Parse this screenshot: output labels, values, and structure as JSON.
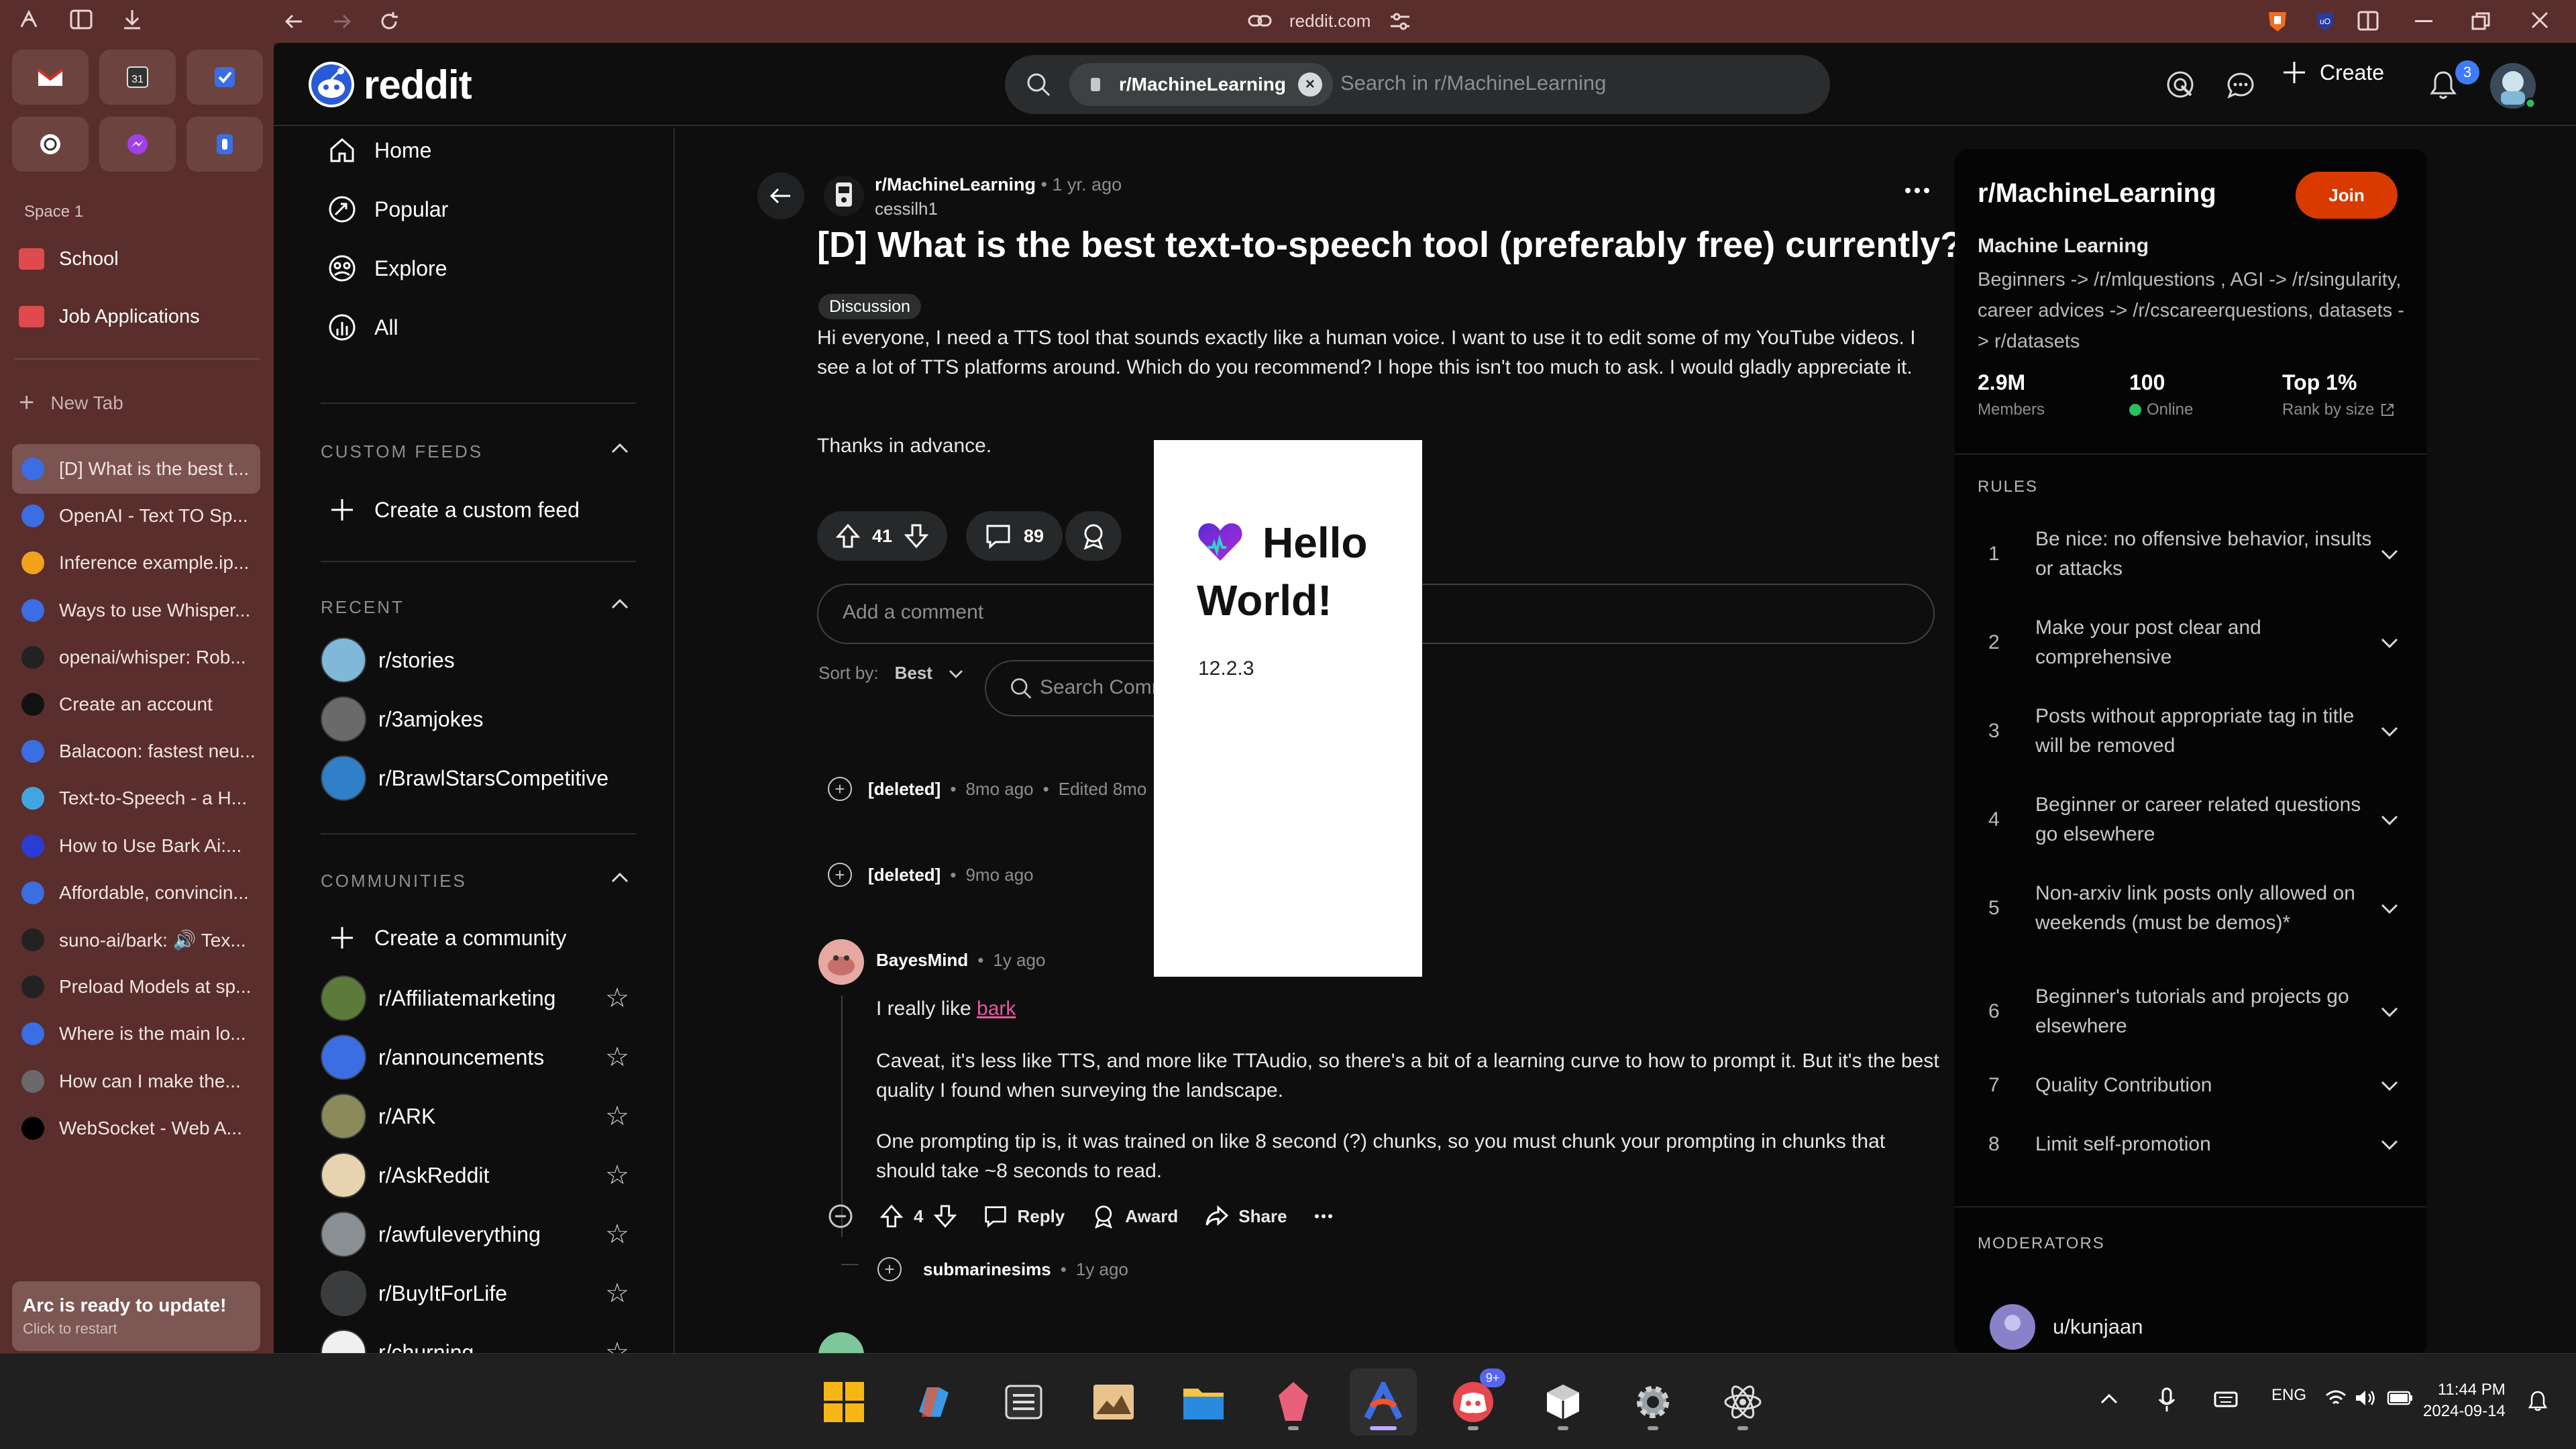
{
  "browser": {
    "url": "reddit.com",
    "space_label": "Space 1",
    "folders": [
      "School",
      "Job Applications"
    ],
    "new_tab_label": "New Tab",
    "tabs": [
      {
        "title": "[D] What is the best t...",
        "color": "#3b6de3",
        "active": true
      },
      {
        "title": "OpenAI - Text TO Sp...",
        "color": "#3b6de3"
      },
      {
        "title": "Inference example.ip...",
        "color": "#f2a21b"
      },
      {
        "title": "Ways to use Whisper...",
        "color": "#3b6de3"
      },
      {
        "title": "openai/whisper: Rob...",
        "color": "#222222"
      },
      {
        "title": "Create an account",
        "color": "#111111"
      },
      {
        "title": "Balacoon: fastest neu...",
        "color": "#3b6de3"
      },
      {
        "title": "Text-to-Speech - a H...",
        "color": "#42a5e0"
      },
      {
        "title": "How to Use Bark Ai:...",
        "color": "#2b3bd6"
      },
      {
        "title": "Affordable, convincin...",
        "color": "#3b6de3"
      },
      {
        "title": "suno-ai/bark: 🔊 Tex...",
        "color": "#222222"
      },
      {
        "title": "Preload Models at sp...",
        "color": "#222222"
      },
      {
        "title": "Where is the main lo...",
        "color": "#3b6de3"
      },
      {
        "title": "How can I make the...",
        "color": "#6a6a6a"
      },
      {
        "title": "WebSocket - Web A...",
        "color": "#000000"
      }
    ],
    "update_title": "Arc is ready to update!",
    "update_sub": "Click to restart"
  },
  "header": {
    "logo": "reddit",
    "search_chip": "r/MachineLearning",
    "search_placeholder": "Search in r/MachineLearning",
    "create_label": "Create",
    "notification_count": "3"
  },
  "left_nav": {
    "main": [
      "Home",
      "Popular",
      "Explore",
      "All"
    ],
    "custom_feeds_title": "CUSTOM FEEDS",
    "create_custom_feed": "Create a custom feed",
    "recent_title": "RECENT",
    "recent": [
      {
        "name": "r/stories",
        "color": "#7fb8d8"
      },
      {
        "name": "r/3amjokes",
        "color": "#6a6a6a"
      },
      {
        "name": "r/BrawlStarsCompetitive",
        "color": "#2f7fc9"
      }
    ],
    "communities_title": "COMMUNITIES",
    "create_community": "Create a community",
    "communities": [
      {
        "name": "r/Affiliatemarketing",
        "color": "#5c7a3a"
      },
      {
        "name": "r/announcements",
        "color": "#3b6de3"
      },
      {
        "name": "r/ARK",
        "color": "#8a8a5a"
      },
      {
        "name": "r/AskReddit",
        "color": "#e8d3b0"
      },
      {
        "name": "r/awfuleverything",
        "color": "#8a8f93"
      },
      {
        "name": "r/BuyItForLife",
        "color": "#3a3c3d"
      },
      {
        "name": "r/churning",
        "color": "#f0f0f0"
      }
    ]
  },
  "post": {
    "subreddit": "r/MachineLearning",
    "age": "1 yr. ago",
    "author": "cessilh1",
    "title": "[D] What is the best text-to-speech tool (preferably free) currently?",
    "flair": "Discussion",
    "body": "Hi everyone, I need a TTS tool that sounds exactly like a human voice. I want to use it to edit some of my YouTube videos. I see a lot of TTS platforms around. Which do you recommend? I hope this isn't too much to ask. I would gladly appreciate it.",
    "thanks": "Thanks in advance.",
    "votes": "41",
    "comments": "89",
    "add_comment_placeholder": "Add a comment",
    "sort_by_label": "Sort by:",
    "sort_value": "Best",
    "search_comments_placeholder": "Search Comments"
  },
  "comments": [
    {
      "author": "[deleted]",
      "meta": "8mo ago",
      "edited": "Edited 8mo"
    },
    {
      "author": "[deleted]",
      "meta": "9mo ago"
    },
    {
      "author": "BayesMind",
      "meta": "1y ago",
      "text_prefix": "I really like ",
      "link": "bark",
      "para2": "Caveat, it's less like TTS, and more like TTAudio, so there's a bit of a learning curve to how to prompt it. But it's the best quality I found when surveying the landscape.",
      "para3": "One prompting tip is, it was trained on like 8 second (?) chunks, so you must chunk your prompting in chunks that should take ~8 seconds to read.",
      "votes": "4",
      "reply": "Reply",
      "award": "Award",
      "share": "Share"
    },
    {
      "author": "submarinesims",
      "meta": "1y ago"
    }
  ],
  "sidebar": {
    "name": "r/MachineLearning",
    "join": "Join",
    "title": "Machine Learning",
    "description": "Beginners -> /r/mlquestions , AGI -> /r/singularity, career advices -> /r/cscareerquestions, datasets -> r/datasets",
    "members_value": "2.9M",
    "members_label": "Members",
    "online_value": "100",
    "online_label": "Online",
    "rank_value": "Top 1%",
    "rank_label": "Rank by size",
    "rules_title": "RULES",
    "rules": [
      "Be nice: no offensive behavior, insults or attacks",
      "Make your post clear and comprehensive",
      "Posts without appropriate tag in title will be removed",
      "Beginner or career related questions go elsewhere",
      "Non-arxiv link posts only allowed on weekends (must be demos)*",
      "Beginner's tutorials and projects go elsewhere",
      "Quality Contribution",
      "Limit self-promotion"
    ],
    "moderators_title": "MODERATORS",
    "moderator": "u/kunjaan"
  },
  "popup": {
    "title_line1": "Hello",
    "title_line2": "World!",
    "version": "12.2.3"
  },
  "taskbar": {
    "language": "ENG",
    "time": "11:44 PM",
    "date": "2024-09-14",
    "discord_badge": "9+"
  }
}
